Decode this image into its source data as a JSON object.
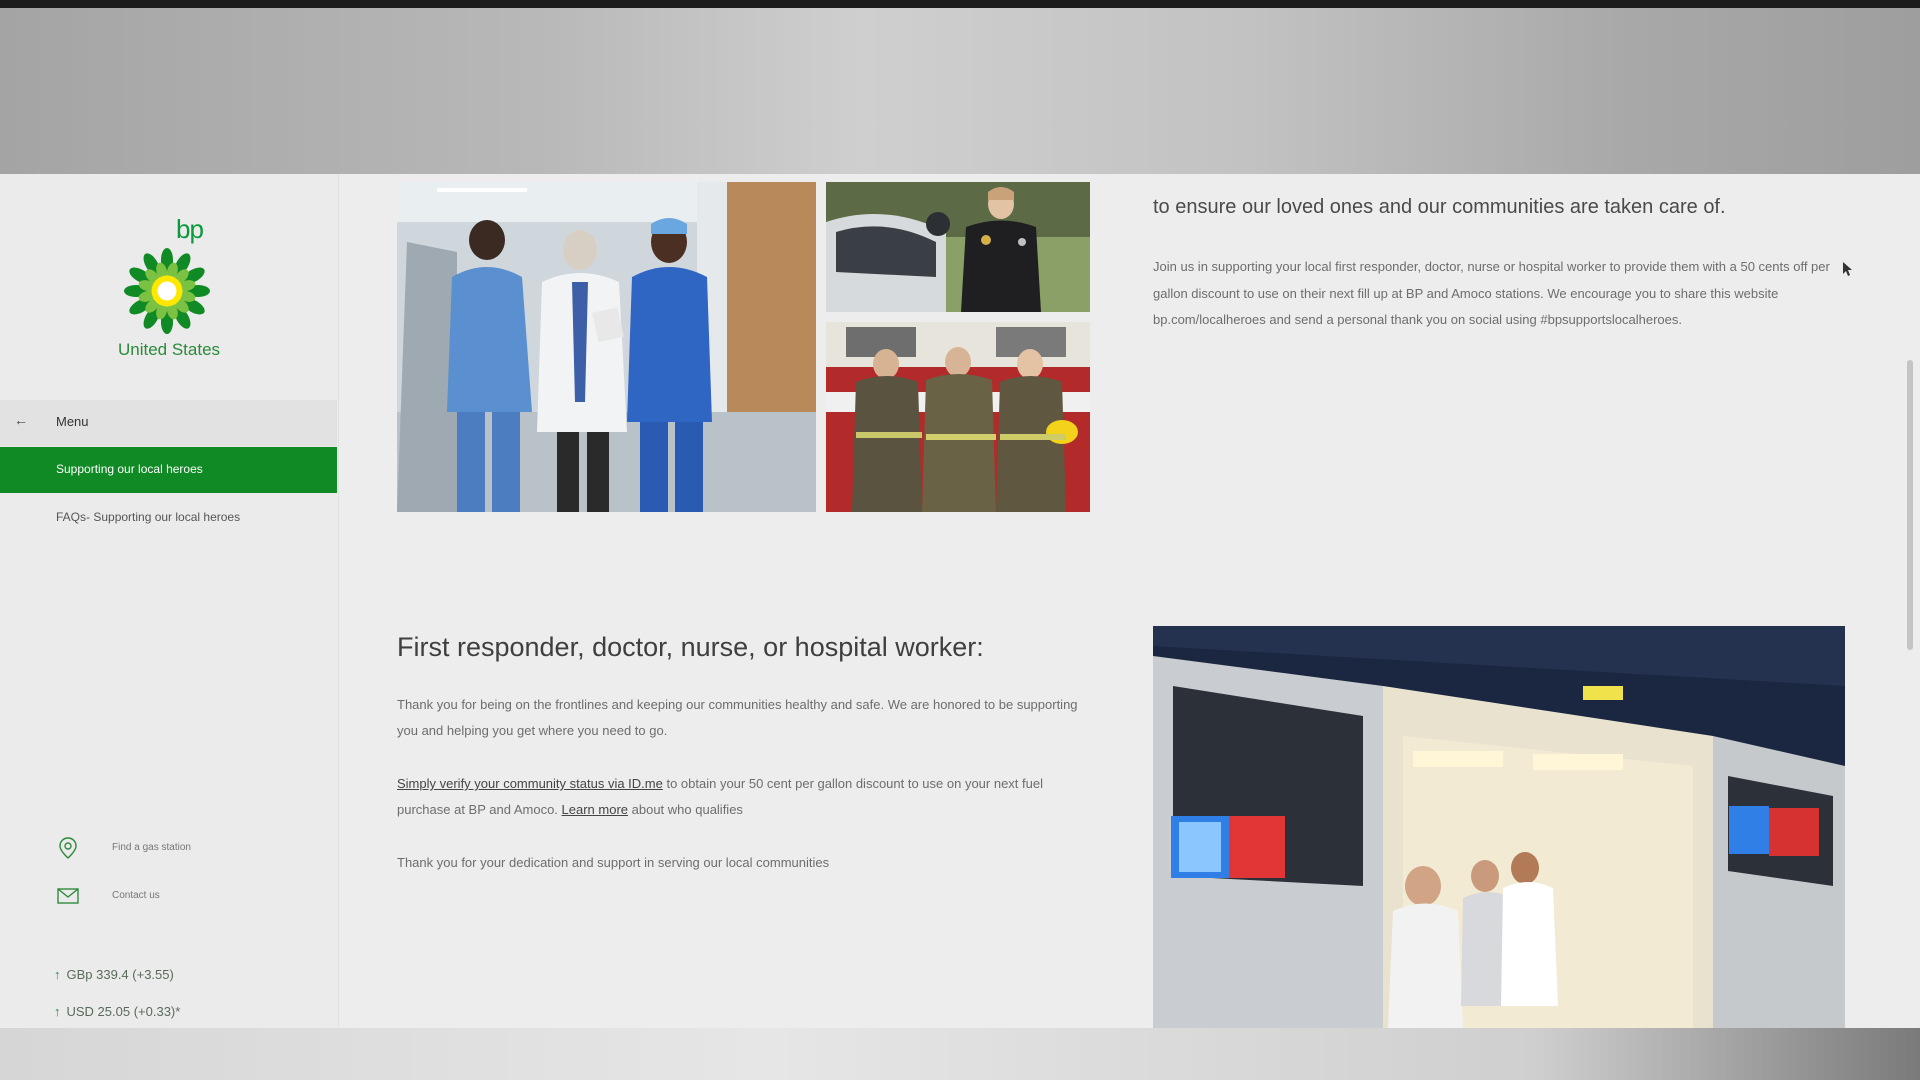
{
  "brand": {
    "logo_text": "bp",
    "country": "United States",
    "colors": {
      "green": "#0f8a24",
      "yellow": "#ffe800"
    }
  },
  "sidebar": {
    "menu_label": "Menu",
    "back_icon": "arrow-left-icon",
    "items": [
      {
        "label": "Supporting our local heroes",
        "active": true
      },
      {
        "label": "FAQs- Supporting our local heroes",
        "active": false
      }
    ],
    "utilities": [
      {
        "label": "Find a gas station",
        "icon": "location-pin-icon"
      },
      {
        "label": "Contact us",
        "icon": "envelope-icon"
      }
    ],
    "tickers": [
      {
        "text": "GBp 339.4 (+3.55)",
        "direction": "up"
      },
      {
        "text": "USD 25.05 (+0.33)*",
        "direction": "up"
      }
    ]
  },
  "main": {
    "tagline": "to ensure our loved ones and our communities are taken care of.",
    "intro": "Join us in supporting your local first responder, doctor, nurse or hospital worker to provide them with a 50 cents off per gallon discount to use on their next fill up at BP and Amoco stations. We encourage you to share this website bp.com/localheroes and send a personal thank you on social using #bpsupportslocalheroes.",
    "section": {
      "heading": "First responder, doctor, nurse, or hospital worker:",
      "para1": "Thank you for being on the frontlines and keeping our communities healthy and safe. We are honored to be supporting you and helping you get where you need to go.",
      "verify_link": "Simply verify your community status via ID.me",
      "para2_mid": " to obtain your 50 cent per gallon discount to use on your next fuel purchase at BP and Amoco. ",
      "learn_more": "Learn more",
      "para2_end": " about who qualifies",
      "para3": "Thank you for your dedication and support in serving our local communities"
    }
  }
}
